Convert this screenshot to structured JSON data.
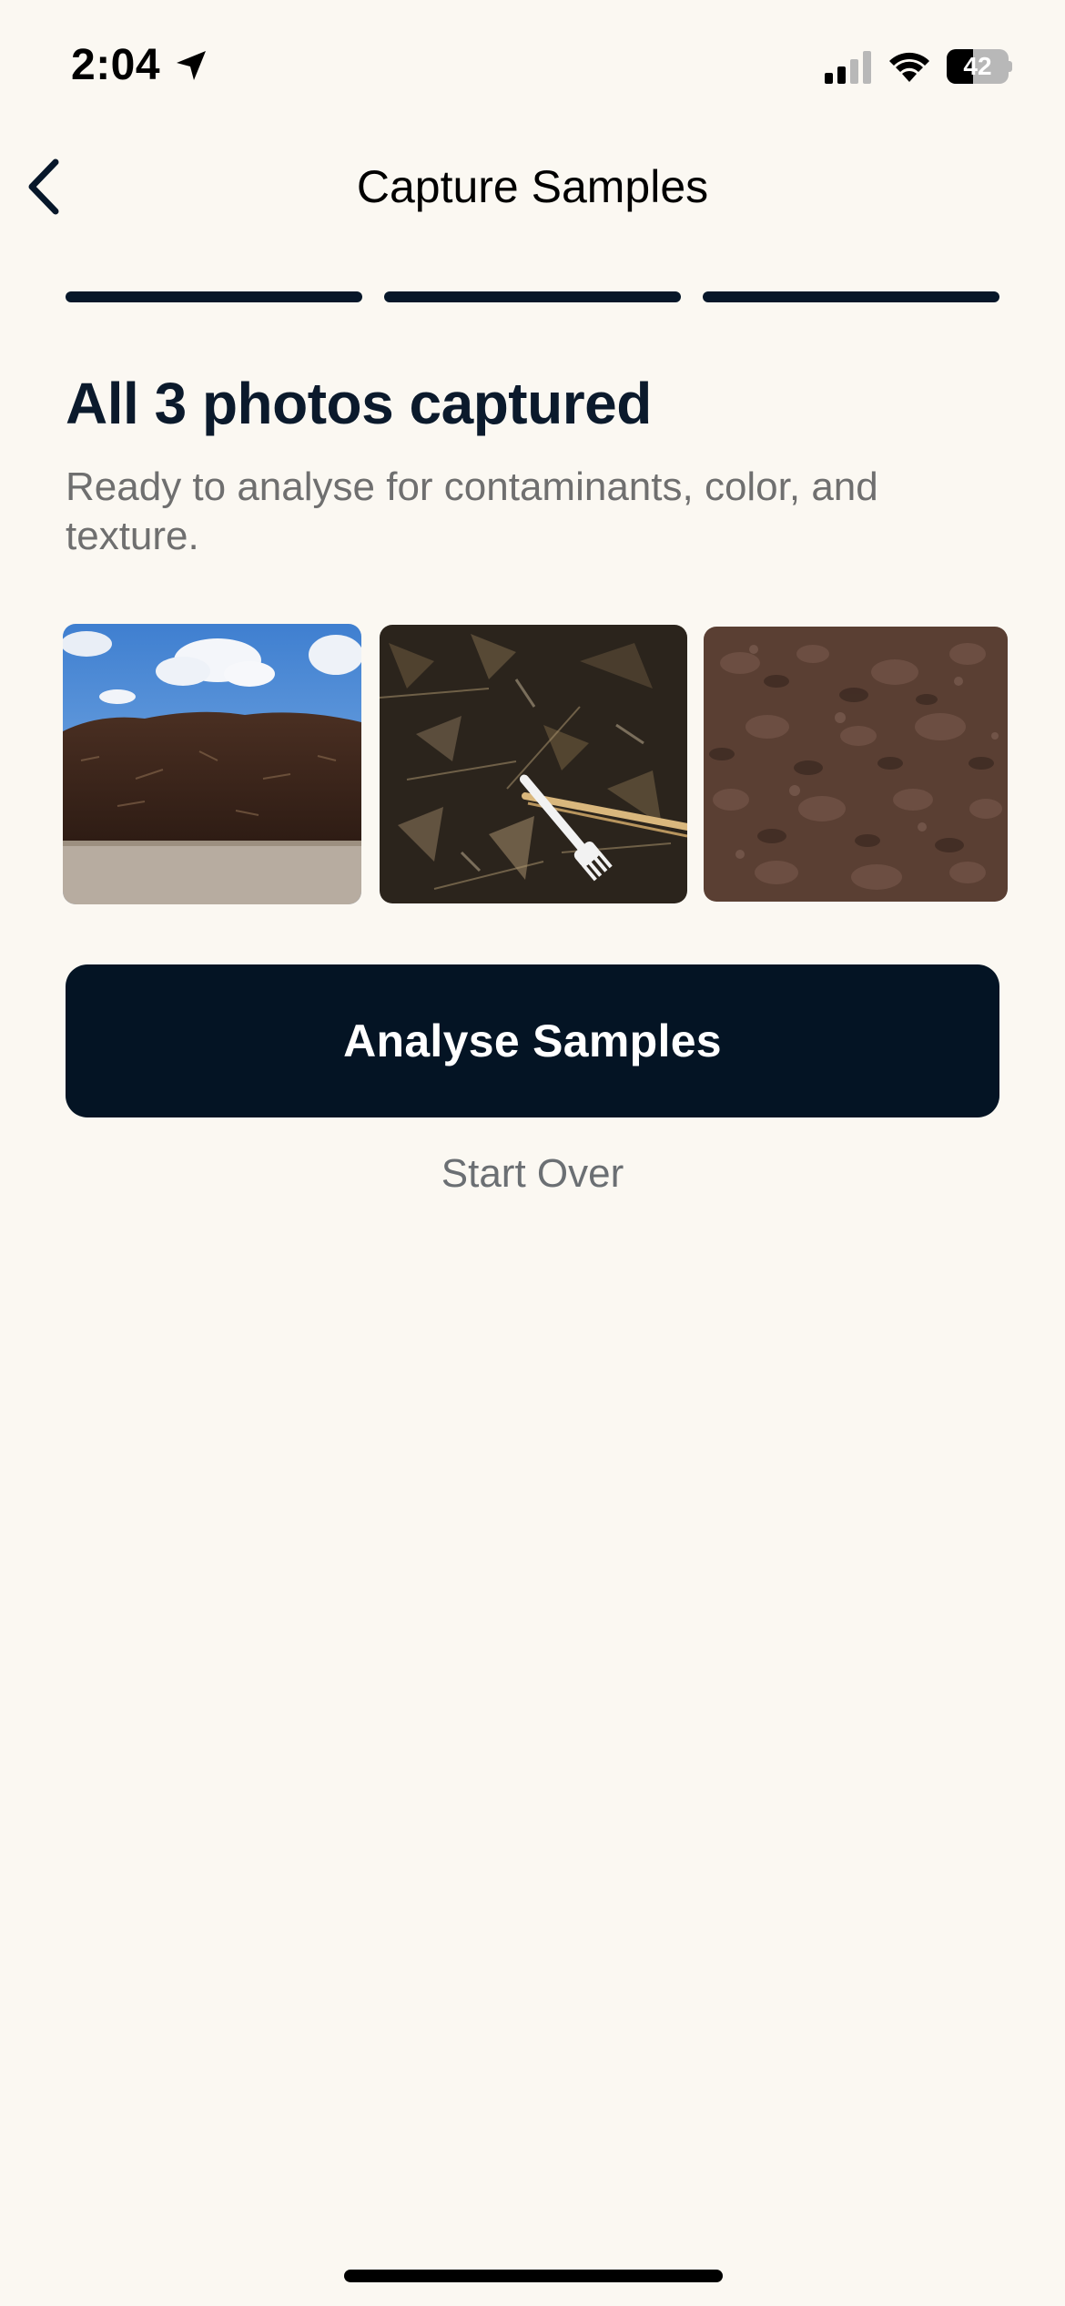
{
  "status_bar": {
    "time": "2:04",
    "battery_level": "42",
    "battery_fraction": 0.42,
    "icons": [
      "location-arrow-icon",
      "cellular-signal-icon",
      "wifi-icon",
      "battery-icon"
    ]
  },
  "nav": {
    "back_icon": "chevron-left-icon",
    "title": "Capture Samples"
  },
  "progress": {
    "steps_total": 3,
    "steps_completed": 3,
    "active_color": "#07172a"
  },
  "content": {
    "headline": "All 3 photos captured",
    "subtitle": "Ready to analyse for contaminants, color, and texture."
  },
  "photos": [
    {
      "subject": "compost pile under blue sky"
    },
    {
      "subject": "close-up of compost with plastic fork and wooden chopstick"
    },
    {
      "subject": "close-up of dark brown soil texture"
    }
  ],
  "actions": {
    "primary_label": "Analyse Samples",
    "secondary_label": "Start Over"
  },
  "colors": {
    "background": "#fbf8f2",
    "primary": "#041424",
    "muted_text": "#6f6f6f"
  }
}
